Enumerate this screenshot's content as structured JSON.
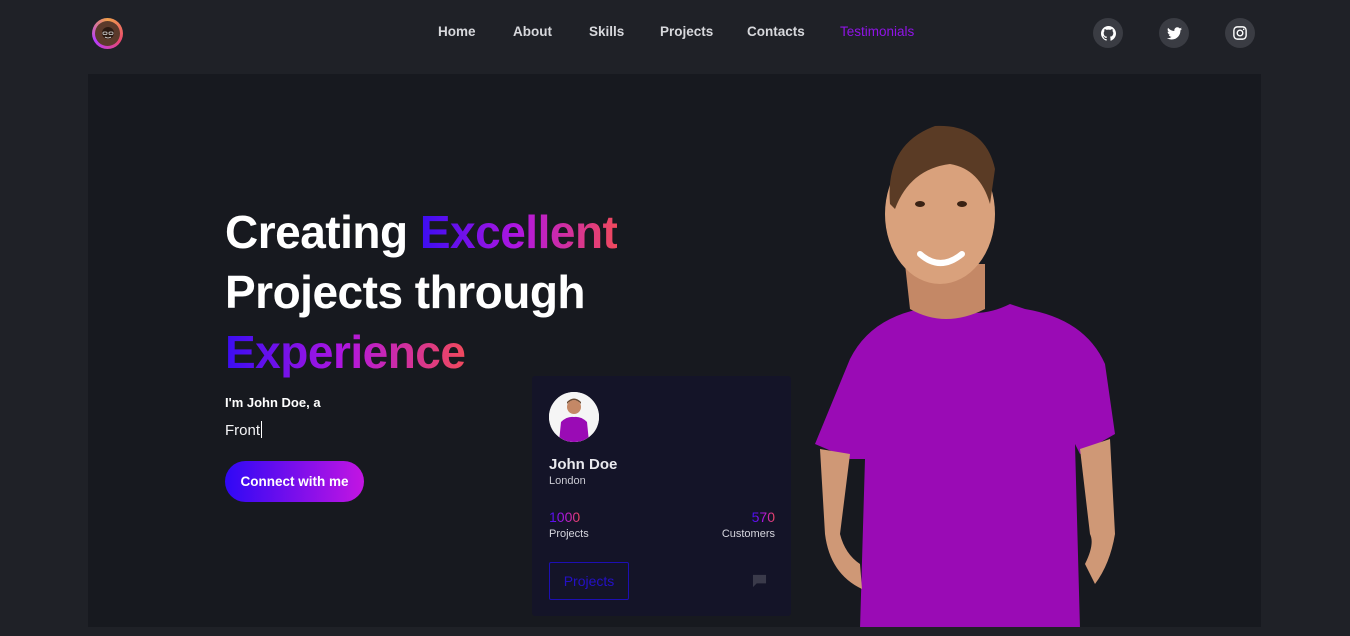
{
  "nav": {
    "links": [
      "Home",
      "About",
      "Skills",
      "Projects",
      "Contacts",
      "Testimonials"
    ],
    "active": "Testimonials",
    "social_icons": [
      "github-icon",
      "twitter-icon",
      "instagram-icon"
    ]
  },
  "hero": {
    "headline": {
      "word1": "Creating",
      "word2": "Excellent",
      "line2": "Projects through",
      "line3": "Experience"
    },
    "intro": "I'm John Doe, a",
    "typed": "Front",
    "cta": "Connect with me"
  },
  "card": {
    "name": "John Doe",
    "city": "London",
    "projects_count": "1000",
    "projects_label": "Projects",
    "customers_count": "570",
    "customers_label": "Customers",
    "button": "Projects"
  },
  "colors": {
    "accent_purple": "#8f14e6",
    "gradient_start": "#3b0df2",
    "gradient_mid": "#b116e0",
    "gradient_end": "#f0495d",
    "shirt": "#9a0bb5"
  }
}
